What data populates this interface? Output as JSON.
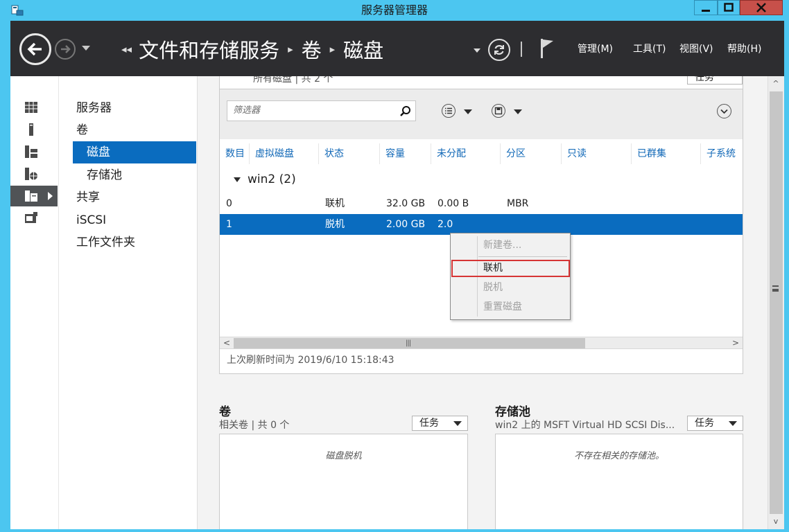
{
  "window": {
    "title": "服务器管理器"
  },
  "header": {
    "breadcrumb": [
      "文件和存储服务",
      "卷",
      "磁盘"
    ],
    "menus": [
      "管理(M)",
      "工具(T)",
      "视图(V)",
      "帮助(H)"
    ]
  },
  "tree": {
    "items": [
      {
        "label": "服务器"
      },
      {
        "label": "卷"
      },
      {
        "label": "磁盘"
      },
      {
        "label": "存储池"
      },
      {
        "label": "共享"
      },
      {
        "label": "iSCSI"
      },
      {
        "label": "工作文件夹"
      }
    ]
  },
  "disks": {
    "header_partial": "所有磁盘 | 共 2 个",
    "task_partial": "任务",
    "filter_placeholder": "筛选器",
    "columns": [
      "数目",
      "虚拟磁盘",
      "状态",
      "容量",
      "未分配",
      "分区",
      "只读",
      "已群集",
      "子系统"
    ],
    "group": "win2 (2)",
    "rows": [
      {
        "num": "0",
        "virtual": "",
        "status": "联机",
        "capacity": "32.0 GB",
        "unallocated": "0.00 B",
        "partition": "MBR"
      },
      {
        "num": "1",
        "virtual": "",
        "status": "脱机",
        "capacity": "2.00 GB",
        "unallocated": "2.0",
        "partition": ""
      }
    ],
    "last_refresh": "上次刷新时间为 2019/6/10 15:18:43"
  },
  "context_menu": {
    "items": [
      {
        "label": "新建卷...",
        "enabled": false
      },
      {
        "label": "联机",
        "enabled": true,
        "highlighted": true
      },
      {
        "label": "脱机",
        "enabled": false
      },
      {
        "label": "重置磁盘",
        "enabled": false
      }
    ]
  },
  "volumes": {
    "title": "卷",
    "subtitle": "相关卷 | 共 0 个",
    "task_label": "任务",
    "empty_message": "磁盘脱机"
  },
  "pools": {
    "title": "存储池",
    "subtitle": "win2 上的 MSFT Virtual HD SCSI Dis...",
    "task_label": "任务",
    "empty_message": "不存在相关的存储池。"
  },
  "colors": {
    "title_bar": "#4cc6f0",
    "header_bg": "#2d2d30",
    "selection": "#0a6cbf",
    "link_text": "#1168b7",
    "highlight_box": "#d63434"
  }
}
